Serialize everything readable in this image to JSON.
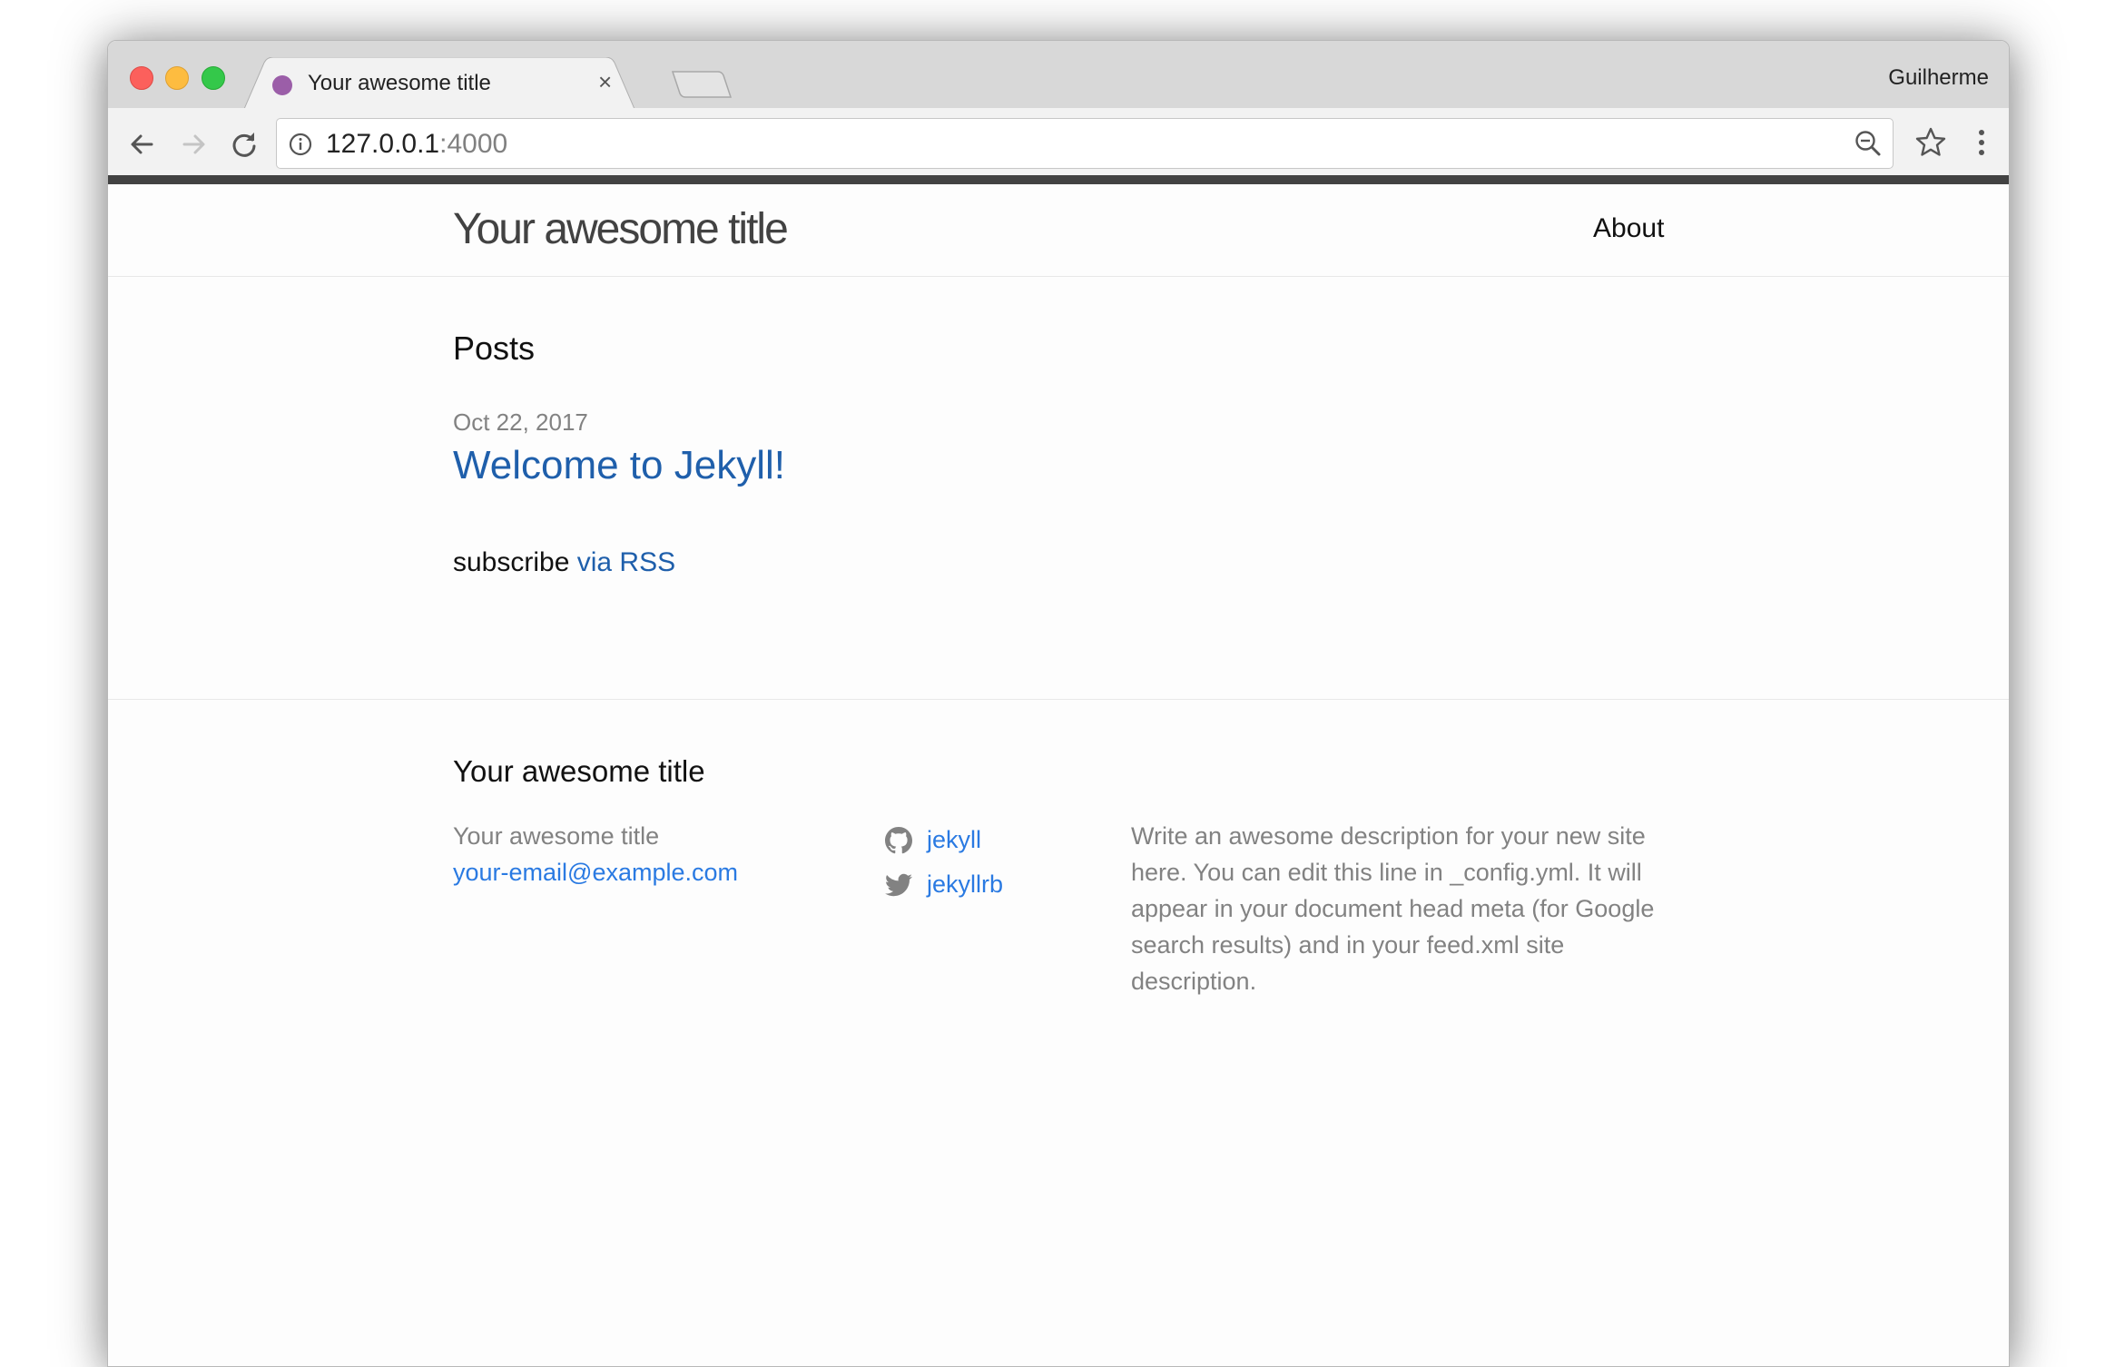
{
  "browser": {
    "tab_title": "Your awesome title",
    "tab_close": "×",
    "profile_name": "Guilherme",
    "address_host": "127.0.0.1",
    "address_port": ":4000"
  },
  "site": {
    "title": "Your awesome title",
    "nav": {
      "about": "About"
    }
  },
  "posts": {
    "heading": "Posts",
    "items": [
      {
        "date": "Oct 22, 2017",
        "title": "Welcome to Jekyll!"
      }
    ],
    "subscribe_text": "subscribe",
    "subscribe_link": "via RSS"
  },
  "footer": {
    "heading": "Your awesome title",
    "name": "Your awesome title",
    "email": "your-email@example.com",
    "github": "jekyll",
    "twitter": "jekyllrb",
    "description": "Write an awesome description for your new site here. You can edit this line in _config.yml. It will appear in your document head meta (for Google search results) and in your feed.xml site description."
  },
  "icons": {
    "back": "back-arrow-icon",
    "forward": "forward-arrow-icon",
    "reload": "reload-icon",
    "info": "info-icon",
    "zoom": "zoom-out-icon",
    "bookmark": "star-icon",
    "menu": "kebab-menu-icon",
    "github": "github-icon",
    "twitter": "twitter-icon"
  },
  "colors": {
    "link": "#2a7ae2",
    "post_link": "#1f5fab",
    "muted": "#828282",
    "header_strip": "#424242",
    "favicon": "#9b5ea8"
  }
}
